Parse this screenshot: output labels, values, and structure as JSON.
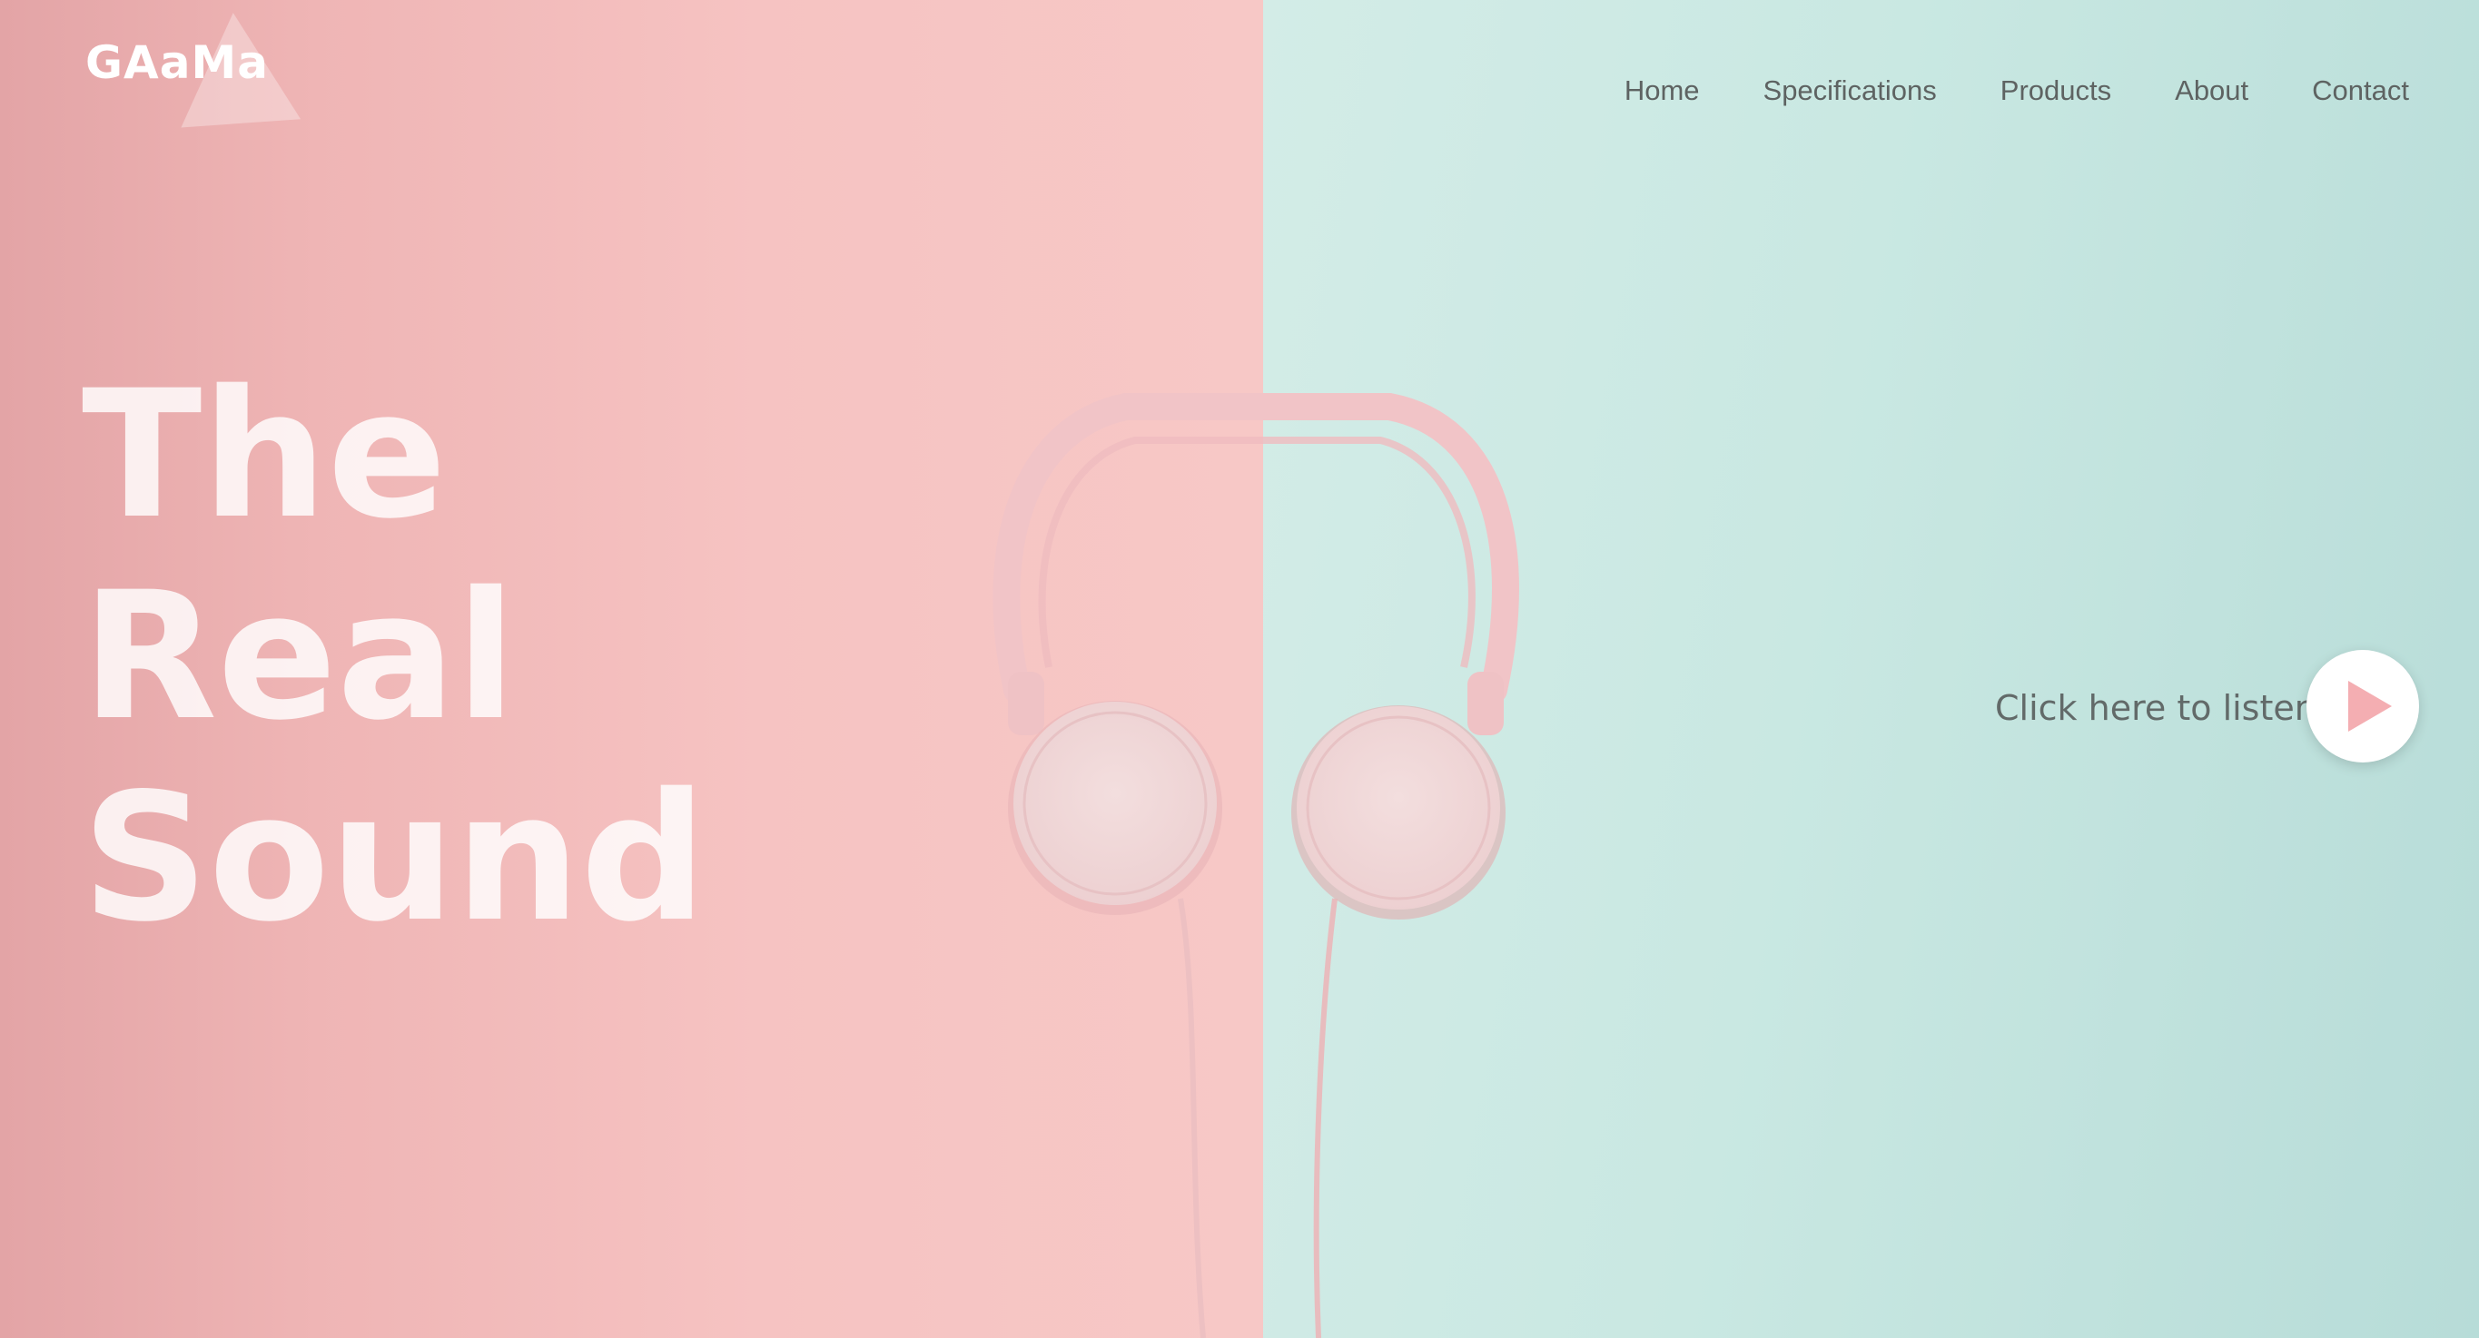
{
  "brand": {
    "logo_text": "GAaMa"
  },
  "nav": {
    "items": [
      {
        "label": "Home"
      },
      {
        "label": "Specifications"
      },
      {
        "label": "Products"
      },
      {
        "label": "About"
      },
      {
        "label": "Contact"
      }
    ]
  },
  "hero": {
    "headline_lines": [
      "The",
      "Real",
      "Sound"
    ],
    "cta_text": "Click here to listen",
    "play_icon": "play-icon",
    "image_subject": "headphones-icon"
  },
  "colors": {
    "left_background": "#f4bebd",
    "right_background": "#c9e8e2",
    "headline": "#ffffff",
    "nav_text": "#5e6362",
    "play_icon": "#f4aeb2",
    "play_button": "#ffffff"
  }
}
